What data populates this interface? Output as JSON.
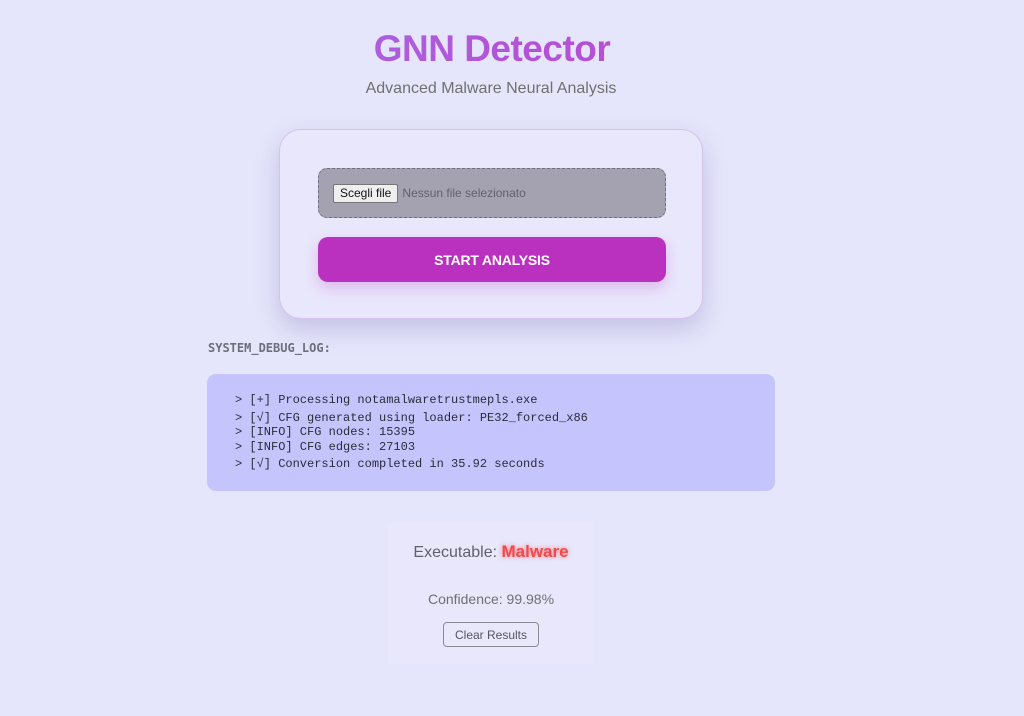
{
  "header": {
    "title": "GNN Detector",
    "subtitle": "Advanced Malware Neural Analysis"
  },
  "upload": {
    "file_button_label": "Scegli file",
    "file_status": "Nessun file selezionato",
    "start_button_label": "START ANALYSIS"
  },
  "debug_log": {
    "label": "SYSTEM_DEBUG_LOG:",
    "lines": [
      "> [+] Processing notamalwaretrustmepls.exe",
      "> [√] CFG generated using loader: PE32_forced_x86",
      "> [INFO] CFG nodes: 15395",
      "> [INFO] CFG edges: 27103",
      "> [√] Conversion completed in 35.92 seconds"
    ]
  },
  "result": {
    "executable_label": "Executable:",
    "executable_value": "Malware",
    "confidence_text": "Confidence: 99.98%",
    "clear_button_label": "Clear Results"
  },
  "colors": {
    "background": "#e5e5fb",
    "accent": "#bb31bf",
    "malware_red": "#f24a4a",
    "log_background": "#c5c4fc"
  }
}
